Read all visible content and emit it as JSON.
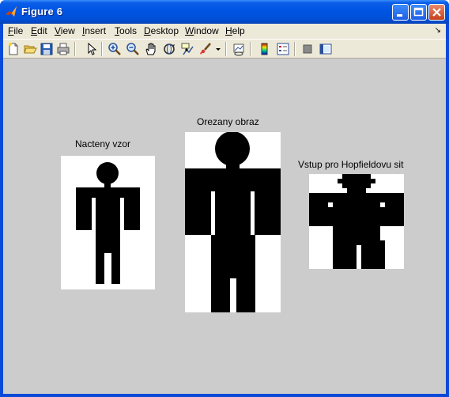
{
  "window": {
    "title": "Figure 6"
  },
  "menu": [
    {
      "key": "F",
      "rest": "ile"
    },
    {
      "key": "E",
      "rest": "dit"
    },
    {
      "key": "V",
      "rest": "iew"
    },
    {
      "key": "I",
      "rest": "nsert"
    },
    {
      "key": "T",
      "rest": "ools"
    },
    {
      "key": "D",
      "rest": "esktop"
    },
    {
      "key": "W",
      "rest": "indow"
    },
    {
      "key": "H",
      "rest": "elp"
    }
  ],
  "toolbar_icons": [
    "new-figure-icon",
    "open-file-icon",
    "save-icon",
    "print-icon",
    "select-arrow-icon",
    "zoom-in-icon",
    "zoom-out-icon",
    "pan-hand-icon",
    "rotate-3d-icon",
    "data-cursor-icon",
    "brush-icon",
    "brush-dropdown-icon",
    "link-plot-icon",
    "colorbar-icon",
    "legend-icon",
    "hide-plot-tools-icon",
    "show-plot-tools-icon"
  ],
  "axes": [
    {
      "title": "Nacteny vzor"
    },
    {
      "title": "Orezany obraz"
    },
    {
      "title": "Vstup pro Hopfieldovu sit"
    }
  ],
  "colors": {
    "canvas": "#cccccc",
    "figure_black": "#000000",
    "figure_white": "#ffffff",
    "title_blue": "#0054e3"
  }
}
